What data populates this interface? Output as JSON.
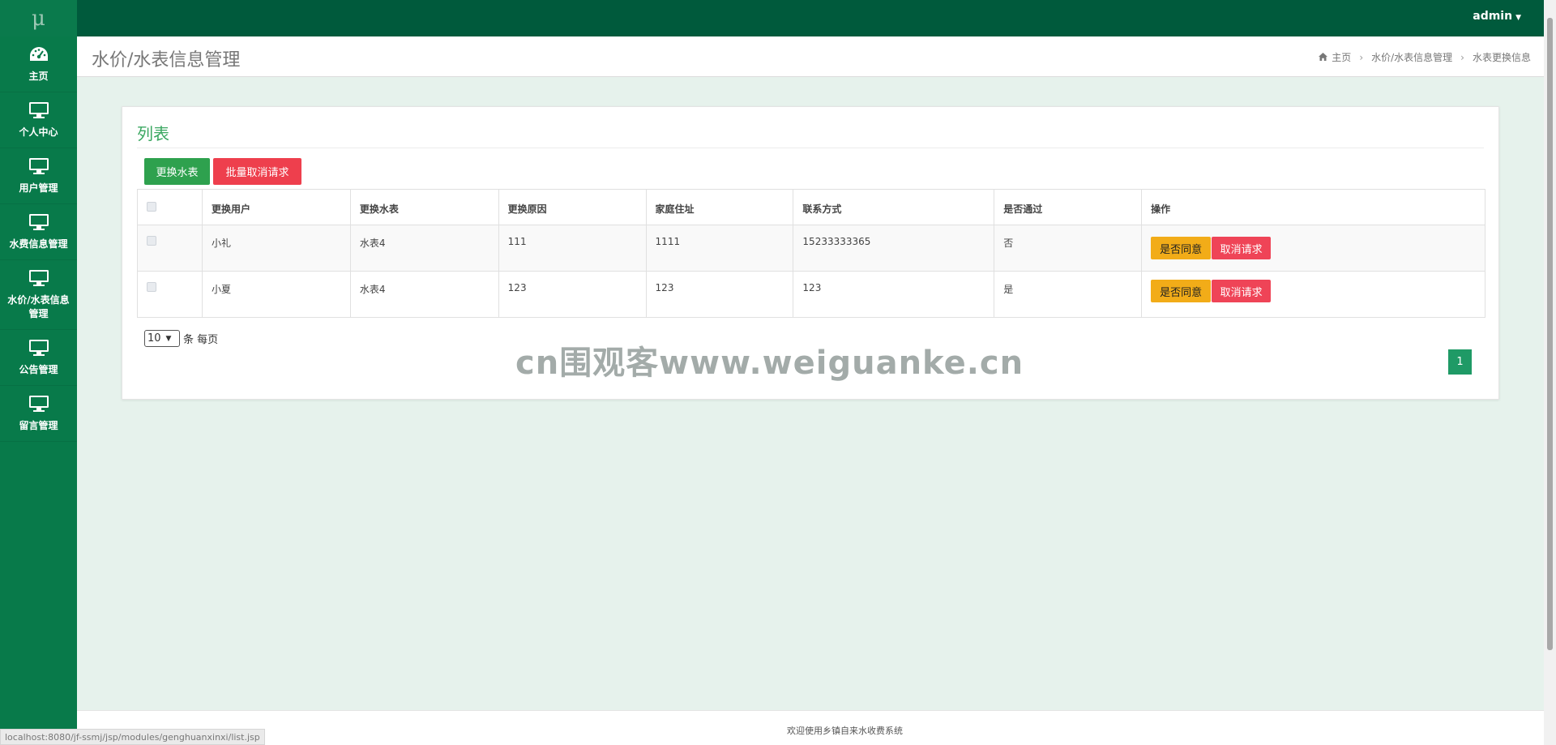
{
  "brand": {
    "logo_text": "μ"
  },
  "user_menu": {
    "label": "admin"
  },
  "sidebar": {
    "items": [
      {
        "label": "主页",
        "icon": "dashboard-icon"
      },
      {
        "label": "个人中心",
        "icon": "monitor-icon"
      },
      {
        "label": "用户管理",
        "icon": "monitor-icon"
      },
      {
        "label": "水费信息管理",
        "icon": "monitor-icon"
      },
      {
        "label": "水价/水表信息管理",
        "icon": "monitor-icon"
      },
      {
        "label": "公告管理",
        "icon": "monitor-icon"
      },
      {
        "label": "留言管理",
        "icon": "monitor-icon"
      }
    ]
  },
  "header": {
    "title": "水价/水表信息管理",
    "breadcrumb": [
      "主页",
      "水价/水表信息管理",
      "水表更换信息"
    ]
  },
  "card": {
    "title": "列表",
    "buttons": {
      "primary": "更换水表",
      "danger": "批量取消请求"
    }
  },
  "table": {
    "columns": [
      "更换用户",
      "更换水表",
      "更换原因",
      "家庭住址",
      "联系方式",
      "是否通过",
      "操作"
    ],
    "rows": [
      {
        "user": "小礼",
        "meter": "水表4",
        "reason": "111",
        "address": "1111",
        "contact": "15233333365",
        "approved": "否"
      },
      {
        "user": "小夏",
        "meter": "水表4",
        "reason": "123",
        "address": "123",
        "contact": "123",
        "approved": "是"
      }
    ],
    "row_actions": {
      "approve": "是否同意",
      "cancel": "取消请求"
    }
  },
  "pagination": {
    "page_size": "10",
    "page_size_unit": "条 每页",
    "current_page": "1"
  },
  "watermark": "cn围观客www.weiguanke.cn",
  "footer": {
    "text": "欢迎使用乡镇自来水收费系统"
  },
  "status_url": "localhost:8080/jf-ssmj/jsp/modules/genghuanxinxi/list.jsp",
  "colors": {
    "topbar": "#005a3c",
    "sidebar": "#087a4a",
    "accent_green": "#2ea14e",
    "danger": "#ee3f4d",
    "warning": "#f2ac18"
  }
}
